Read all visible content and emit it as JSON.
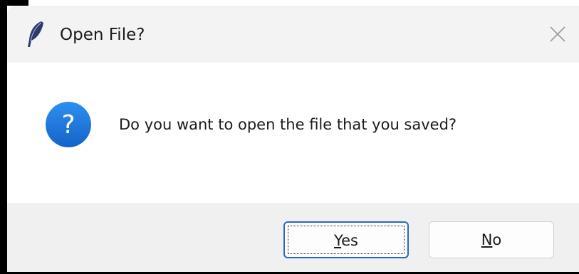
{
  "window": {
    "title": "Open File?",
    "icon": "feather-icon",
    "close_icon": "close-icon"
  },
  "message": {
    "icon": "question-icon",
    "glyph": "?",
    "text": "Do you want to open the file that you saved?"
  },
  "buttons": {
    "yes": {
      "mnemonic": "Y",
      "rest": "es",
      "focused": true
    },
    "no": {
      "mnemonic": "N",
      "rest": "o",
      "focused": false
    }
  },
  "colors": {
    "accent": "#1e73d8",
    "titlebar": "#f3f3f3",
    "footer": "#f0f0f0"
  }
}
